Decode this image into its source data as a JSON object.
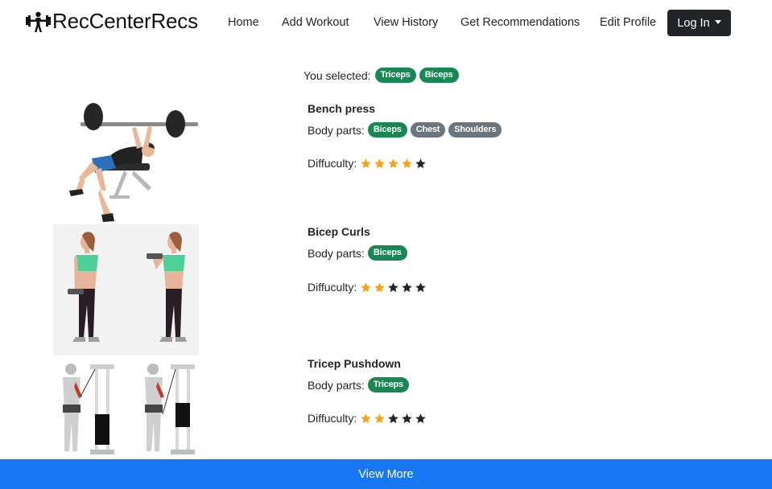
{
  "navbar": {
    "brand": "RecCenterRecs",
    "brand_icon": "weightlifter-icon",
    "links": [
      "Home",
      "Add Workout",
      "View History",
      "Get Recommendations",
      "Edit Profile"
    ],
    "login_label": "Log In"
  },
  "selection": {
    "label": "You selected:",
    "tags": [
      "Triceps",
      "Biceps"
    ]
  },
  "exercises": [
    {
      "title": "Bench press",
      "parts_label": "Body parts:",
      "parts": [
        "Biceps",
        "Chest",
        "Shoulders"
      ],
      "difficulty_label": "Diffuculty:",
      "difficulty": 4,
      "difficulty_max": 5,
      "image": "bench-press-illustration"
    },
    {
      "title": "Bicep Curls",
      "parts_label": "Body parts:",
      "parts": [
        "Biceps"
      ],
      "difficulty_label": "Diffuculty:",
      "difficulty": 2,
      "difficulty_max": 5,
      "image": "bicep-curl-illustration"
    },
    {
      "title": "Tricep Pushdown",
      "parts_label": "Body parts:",
      "parts": [
        "Triceps"
      ],
      "difficulty_label": "Diffuculty:",
      "difficulty": 2,
      "difficulty_max": 5,
      "image": "tricep-pushdown-illustration"
    }
  ],
  "footer": {
    "view_more": "View More"
  },
  "colors": {
    "badge_green": "#198754",
    "badge_gray": "#6c757d",
    "star_filled": "#f5a21b",
    "star_empty": "#212529",
    "primary": "#1877f2",
    "dark": "#212529"
  }
}
